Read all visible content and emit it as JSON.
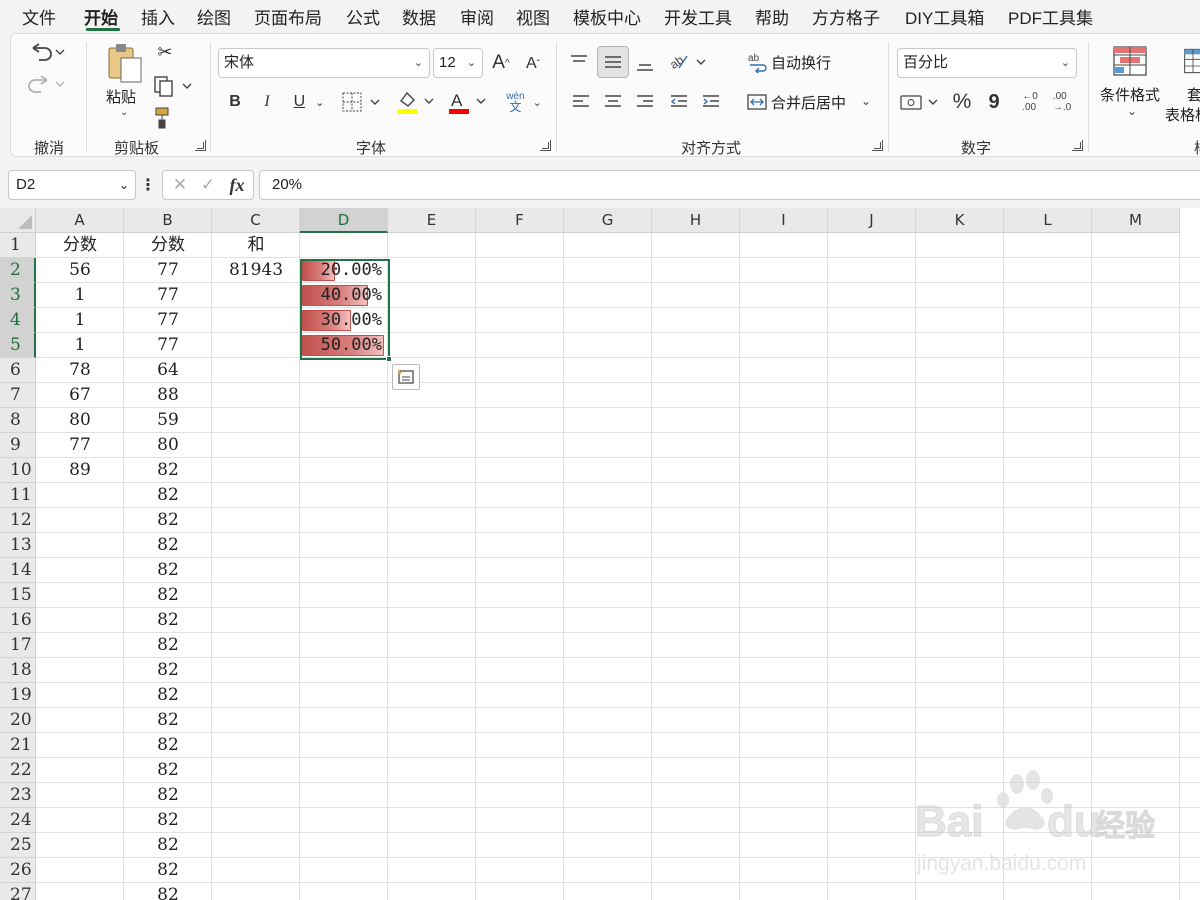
{
  "menu": {
    "items": [
      "文件",
      "开始",
      "插入",
      "绘图",
      "页面布局",
      "公式",
      "数据",
      "审阅",
      "视图",
      "模板中心",
      "开发工具",
      "帮助",
      "方方格子",
      "DIY工具箱",
      "PDF工具集"
    ],
    "active": "开始"
  },
  "ribbon": {
    "undo_group": "撤消",
    "clipboard": {
      "paste": "粘贴",
      "label": "剪贴板"
    },
    "font": {
      "name": "宋体",
      "size": "12",
      "label": "字体",
      "bold": "B",
      "italic": "I",
      "underline": "U",
      "grow": "A",
      "shrink": "A",
      "color_letter": "A",
      "phonetic_top": "wén",
      "phonetic_bottom": "文",
      "fill_color": "#ffff00",
      "font_color": "#ff0000"
    },
    "alignment": {
      "wrap": "自动换行",
      "merge": "合并后居中",
      "label": "对齐方式"
    },
    "number": {
      "format": "百分比",
      "percent": "%",
      "comma": "9",
      "inc_top": "←0",
      "inc_bottom": ".00",
      "dec_top": ".00",
      "dec_bottom": "→.0",
      "label": "数字"
    },
    "styles": {
      "conditional": "条件格式",
      "table_top": "套",
      "table": "表格格",
      "partial_label": "样"
    }
  },
  "formula_bar": {
    "name_box": "D2",
    "cancel": "✕",
    "enter": "✓",
    "fx": "fx",
    "value": "20%"
  },
  "grid": {
    "columns": [
      "A",
      "B",
      "C",
      "D",
      "E",
      "F",
      "G",
      "H",
      "I",
      "J",
      "K",
      "L",
      "M"
    ],
    "selected_column": "D",
    "rows": [
      "1",
      "2",
      "3",
      "4",
      "5",
      "6",
      "7",
      "8",
      "9",
      "10",
      "11",
      "12",
      "13",
      "14",
      "15",
      "16",
      "17",
      "18",
      "19",
      "20",
      "21",
      "22",
      "23",
      "24",
      "25",
      "26",
      "27"
    ],
    "selected_rows": [
      "2",
      "3",
      "4",
      "5"
    ],
    "col_a": [
      "分数",
      "56",
      "1",
      "1",
      "1",
      "78",
      "67",
      "80",
      "77",
      "89"
    ],
    "col_b": [
      "分数",
      "77",
      "77",
      "77",
      "77",
      "64",
      "88",
      "59",
      "80",
      "82",
      "82",
      "82",
      "82",
      "82",
      "82",
      "82",
      "82",
      "82",
      "82",
      "82",
      "82",
      "82",
      "82",
      "82",
      "82",
      "82",
      "82"
    ],
    "col_c": [
      "和",
      "81943"
    ],
    "col_d": [
      "20.00%",
      "40.00%",
      "30.00%",
      "50.00%"
    ],
    "databar_fractions": [
      0.4,
      0.8,
      0.6,
      1.0
    ],
    "databar_color": "#c0504d"
  },
  "watermark": {
    "brand": "Bai",
    "brand_end": "du",
    "brand_cn": "经验",
    "url": "jingyan.baidu.com"
  }
}
